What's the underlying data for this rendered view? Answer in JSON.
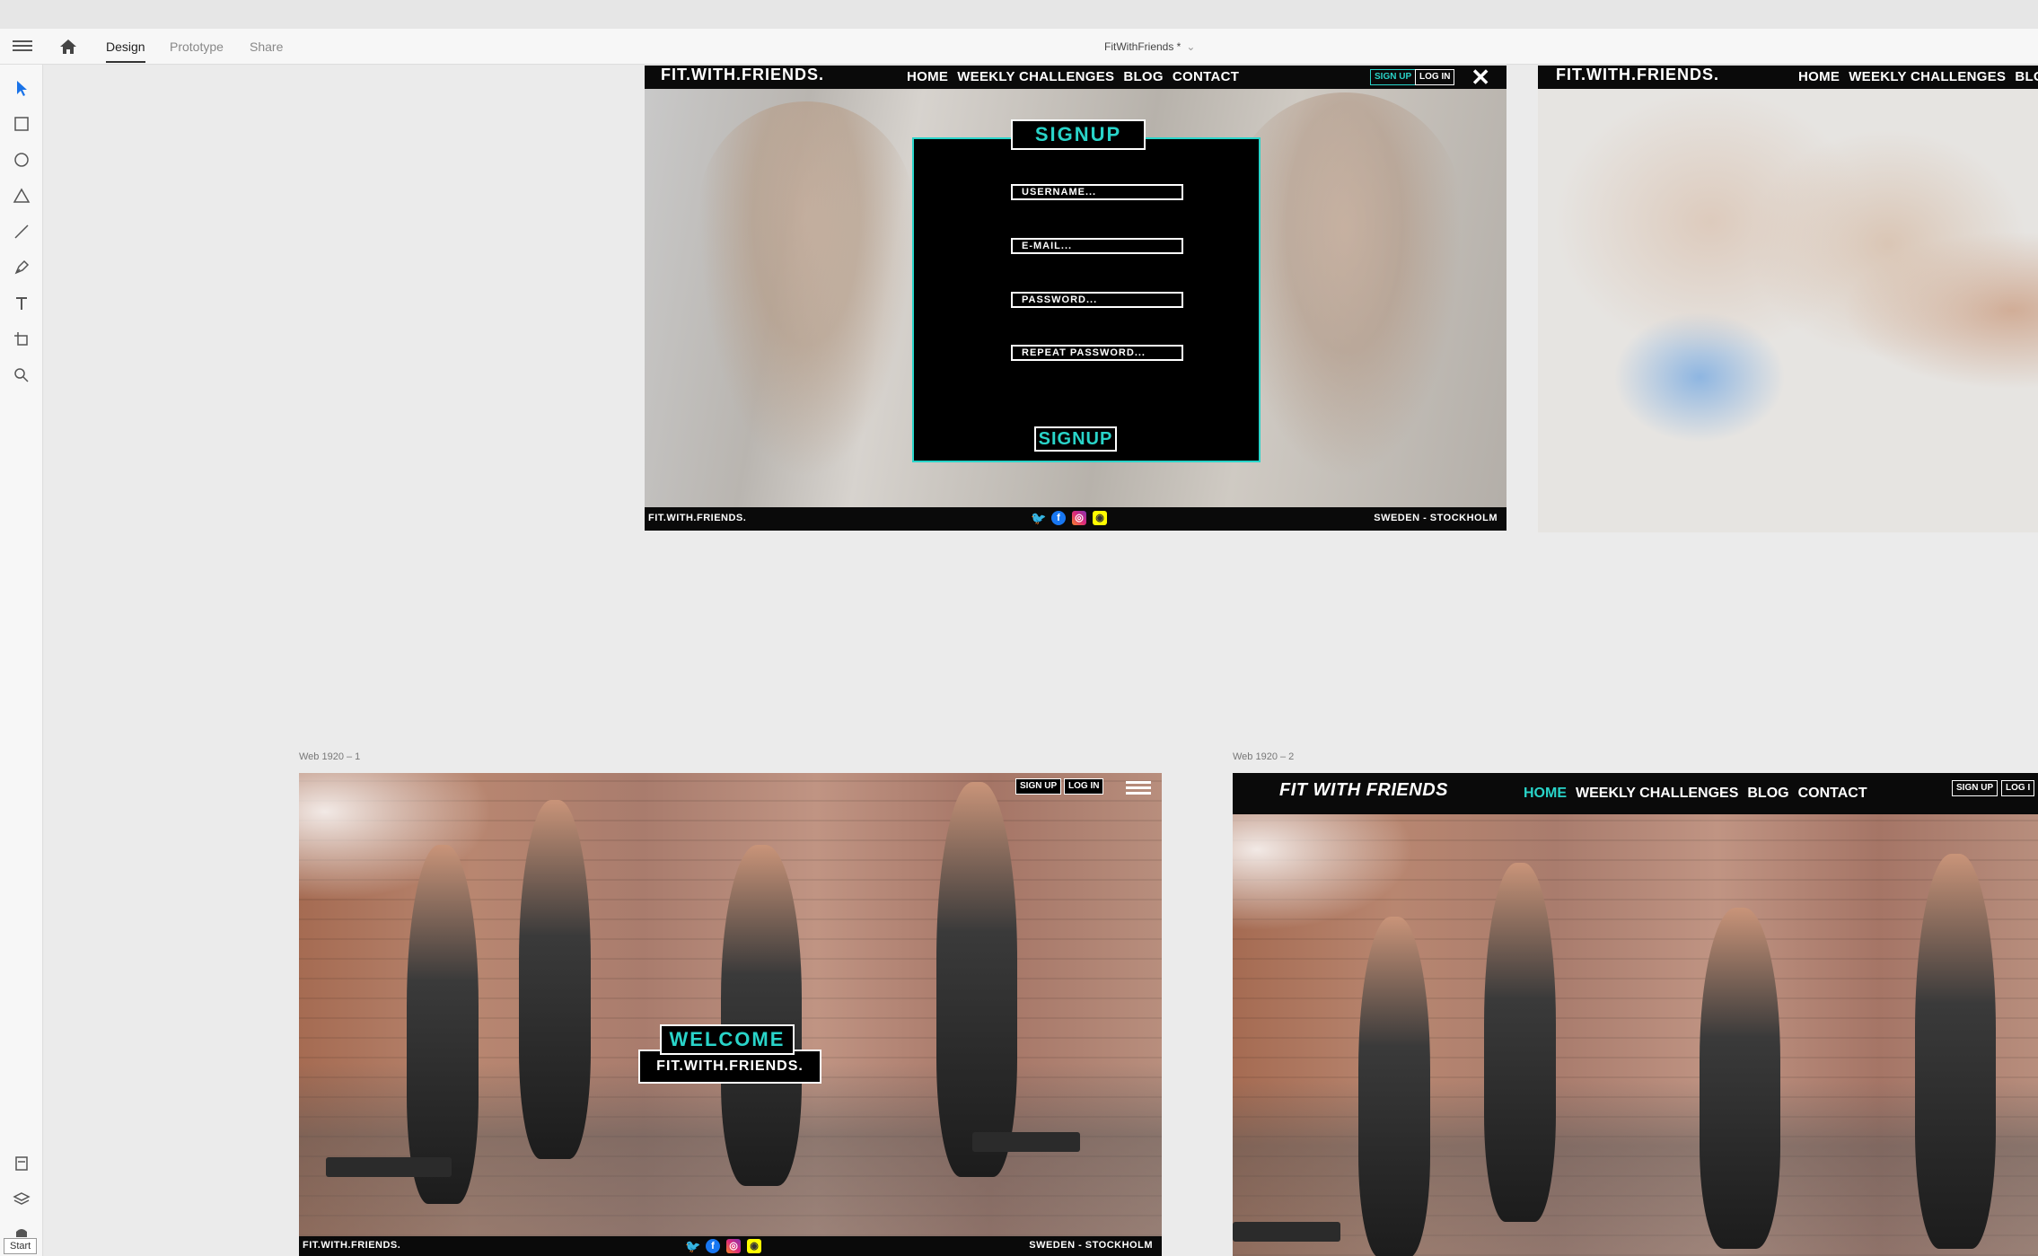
{
  "app": {
    "tabs": [
      {
        "label": "Design",
        "active": true
      },
      {
        "label": "Prototype",
        "active": false
      },
      {
        "label": "Share",
        "active": false
      }
    ],
    "document_title": "FitWithFriends *"
  },
  "tools": [
    "select-tool-icon",
    "rectangle-tool-icon",
    "ellipse-tool-icon",
    "triangle-tool-icon",
    "line-tool-icon",
    "pen-tool-icon",
    "text-tool-icon",
    "artboard-tool-icon",
    "zoom-tool-icon",
    "assets-icon",
    "layers-icon",
    "plugins-icon"
  ],
  "colors": {
    "accent": "#29d4c9",
    "dark": "#0a0a0a"
  },
  "signup_artboard": {
    "logo": "FIT.WITH.FRIENDS.",
    "nav": [
      "HOME",
      "WEEKLY CHALLENGES",
      "BLOG",
      "CONTACT"
    ],
    "signup_button": "SIGN UP",
    "login_button": "LOG IN",
    "close_icon": "close-icon",
    "title": "SIGNUP",
    "fields": [
      "USERNAME...",
      "E-MAIL...",
      "PASSWORD...",
      "REPEAT PASSWORD..."
    ],
    "submit": "SIGNUP",
    "footer_brand": "FIT.WITH.FRIENDS.",
    "footer_location": "SWEDEN - STOCKHOLM"
  },
  "top_right_artboard": {
    "logo": "FIT.WITH.FRIENDS.",
    "nav": [
      "HOME",
      "WEEKLY CHALLENGES",
      "BLO"
    ]
  },
  "web1": {
    "label": "Web 1920 – 1",
    "signup_button": "SIGN UP",
    "login_button": "LOG IN",
    "welcome": "WELCOME",
    "subtitle": "FIT.WITH.FRIENDS.",
    "footer_brand": "FIT.WITH.FRIENDS.",
    "footer_location": "SWEDEN - STOCKHOLM"
  },
  "web2": {
    "label": "Web 1920 – 2",
    "logo": "FIT WITH FRIENDS",
    "nav": [
      "HOME",
      "WEEKLY CHALLENGES",
      "BLOG",
      "CONTACT"
    ],
    "signup_button": "SIGN UP",
    "login_button": "LOG I"
  },
  "taskbar": {
    "start": "Start"
  }
}
